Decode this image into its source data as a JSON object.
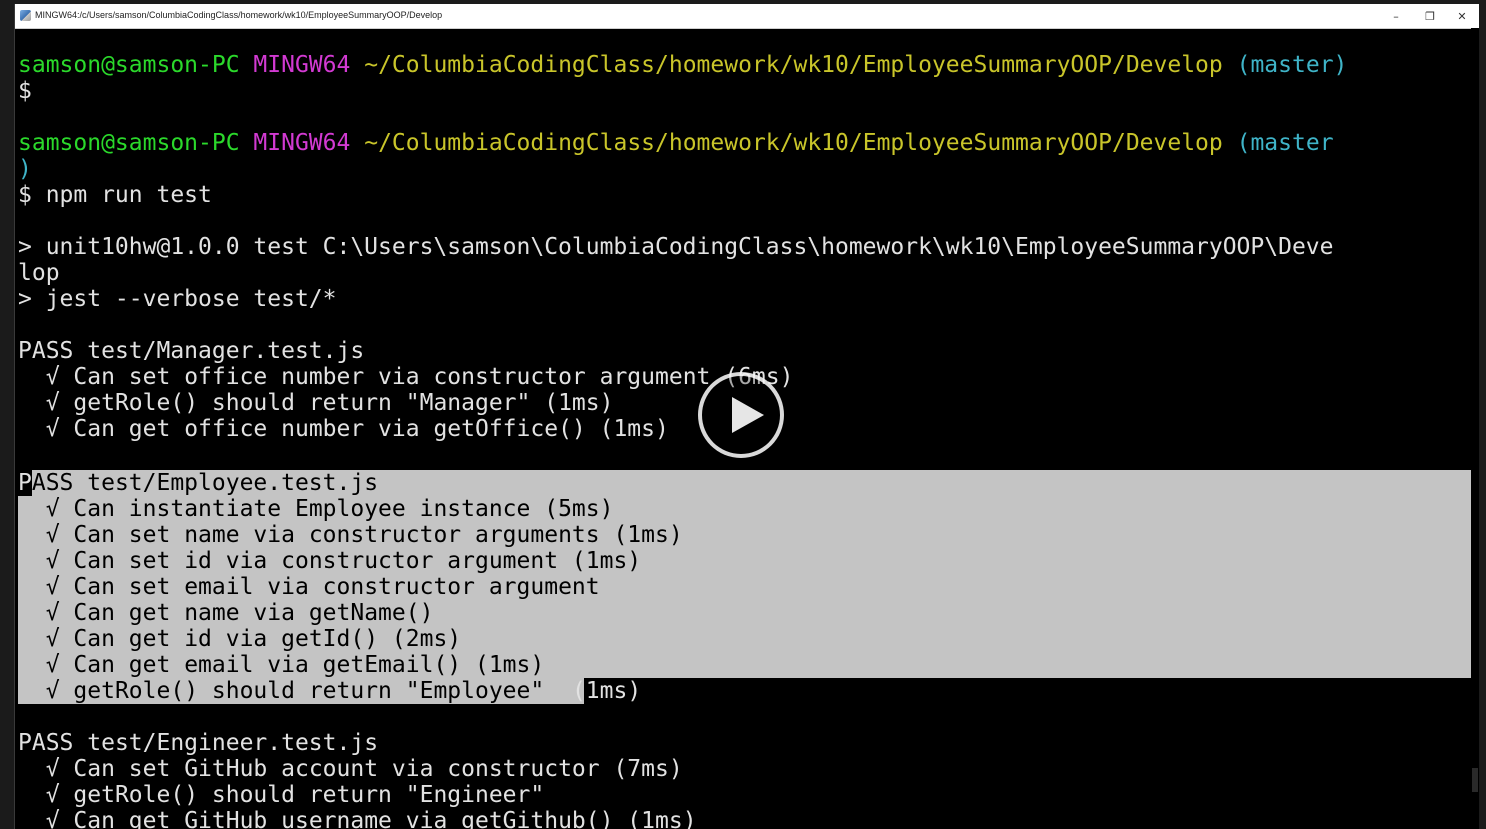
{
  "window": {
    "title": "MINGW64:/c/Users/samson/ColumbiaCodingClass/homework/wk10/EmployeeSummaryOOP/Develop",
    "controls": {
      "minimize": "–",
      "maximize": "❐",
      "close": "✕"
    }
  },
  "prompt": {
    "user": "samson@samson-PC",
    "shell": "MINGW64",
    "path": "~/ColumbiaCodingClass/homework/wk10/EmployeeSummaryOOP/Develop",
    "branch": "(master)",
    "branch_wrapped_head": "(master",
    "branch_wrapped_tail": ")",
    "symbol": "$"
  },
  "command": "$ npm run test",
  "npm_output": {
    "line1": "> unit10hw@1.0.0 test C:\\Users\\samson\\ColumbiaCodingClass\\homework\\wk10\\EmployeeSummaryOOP\\Deve",
    "line2": "lop",
    "line3": "> jest --verbose test/*"
  },
  "suites": [
    {
      "status": "PASS",
      "file": "test/Manager.test.js",
      "tests": [
        "Can set office number via constructor argument (6ms)",
        "getRole() should return \"Manager\" (1ms)",
        "Can get office number via getOffice() (1ms)"
      ]
    },
    {
      "status": "PASS",
      "file": "test/Employee.test.js",
      "tests": [
        "Can instantiate Employee instance (5ms)",
        "Can set name via constructor arguments (1ms)",
        "Can set id via constructor argument (1ms)",
        "Can set email via constructor argument",
        "Can get name via getName()",
        "Can get id via getId() (2ms)",
        "Can get email via getEmail() (1ms)",
        "getRole() should return \"Employee\""
      ],
      "last_test_tail": " (1ms)"
    },
    {
      "status": "PASS",
      "file": "test/Engineer.test.js",
      "tests": [
        "Can set GitHub account via constructor (7ms)",
        "getRole() should return \"Engineer\"",
        "Can get GitHub username via getGithub() (1ms)"
      ]
    }
  ],
  "check_glyph": "√",
  "pass_first_char": "P",
  "pass_rest": "ASS test/Employee.test.js",
  "icons": {
    "play": "play-icon",
    "app": "terminal-app-icon"
  },
  "colors": {
    "user": "#2bd92b",
    "shell": "#d23ad2",
    "path": "#c9c52a",
    "branch": "#3fb4c8",
    "selection": "#c4c4c4"
  }
}
